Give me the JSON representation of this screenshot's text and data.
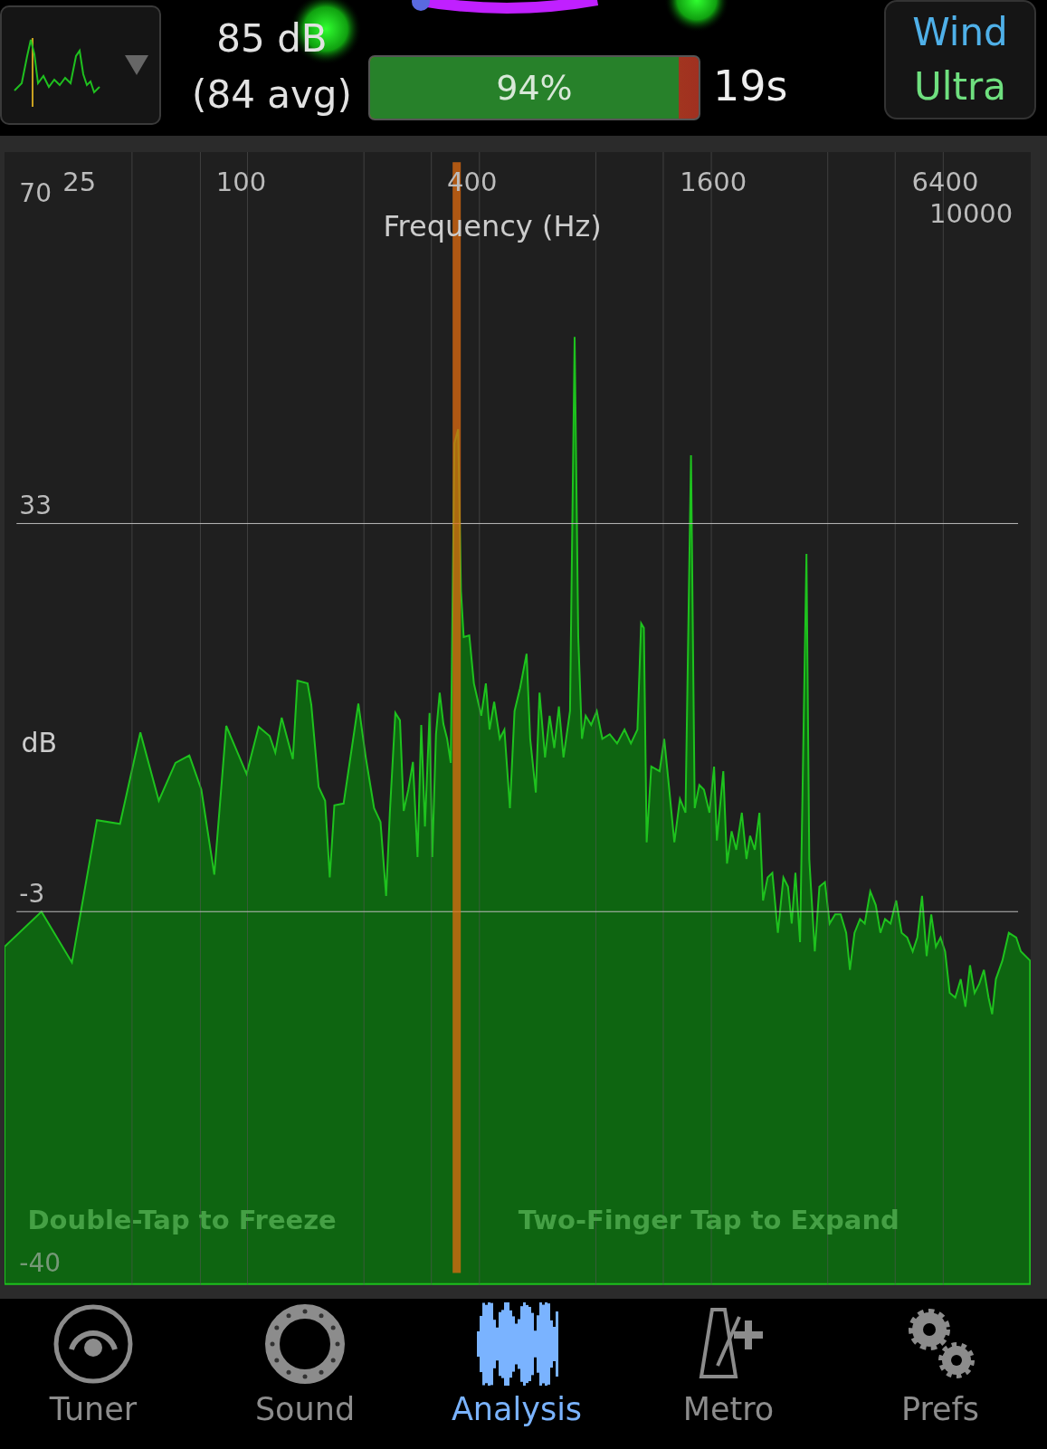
{
  "header": {
    "level_readout": "85 dB",
    "average_readout": "(84 avg)",
    "progress": {
      "label": "94%",
      "level": 0.94
    },
    "timer": "19s",
    "mode": {
      "line_1": "Wind",
      "line_2": "Ultra"
    }
  },
  "chart": {
    "x_axis_title": "Frequency (Hz)",
    "x_ticks": [
      "25",
      "100",
      "400",
      "1600",
      "6400",
      "10000"
    ],
    "y_axis_title": "dB",
    "y_ticks": [
      "70",
      "33",
      "-3",
      "-40"
    ],
    "hints": [
      "Double-Tap to Freeze",
      "Two-Finger Tap to Expand"
    ]
  },
  "tabs": [
    {
      "label": "Tuner",
      "selected": false
    },
    {
      "label": "Sound",
      "selected": false
    },
    {
      "label": "Analysis",
      "selected": true
    },
    {
      "label": "Metro",
      "selected": false
    },
    {
      "label": "Prefs",
      "selected": false
    }
  ]
}
